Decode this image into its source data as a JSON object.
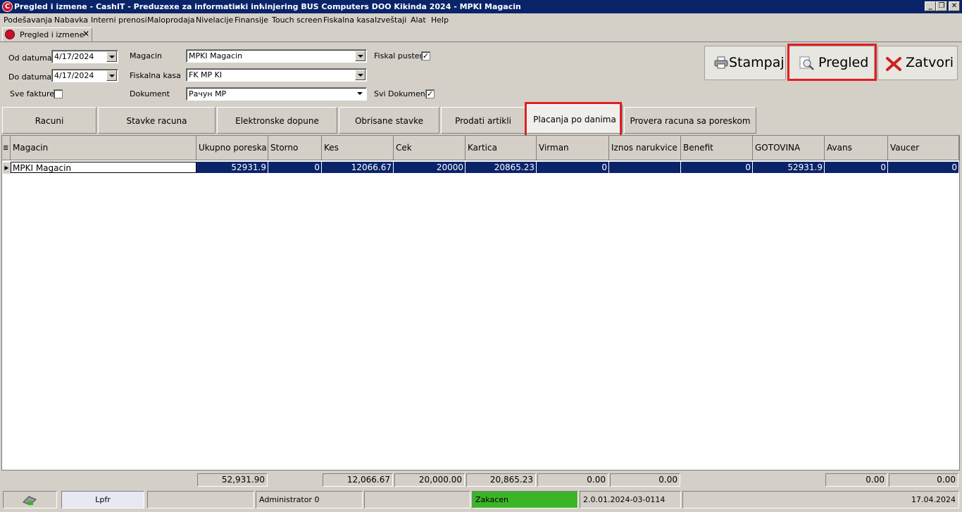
{
  "window": {
    "title": "Pregled i izmene - CashIT - Preduzexe za informatiиki inћinjering BUS Computers DOO Kikinda 2024 - MPKI Magacin",
    "app_icon_letter": "C",
    "minimize": "_",
    "restore": "❐",
    "close": "✕"
  },
  "menu": [
    "Podešavanja",
    "Nabavka",
    "Interni prenosi",
    "Maloprodaja",
    "Nivelacije",
    "Finansije",
    "Touch screen",
    "Fiskalna kasa",
    "Izveštaji",
    "Alat",
    "Help"
  ],
  "doc_tab": {
    "label": "Pregled i izmene",
    "close": "✕"
  },
  "form": {
    "od_datuma_label": "Od datuma",
    "od_datuma_value": "4/17/2024",
    "do_datuma_label": "Do datuma",
    "do_datuma_value": "4/17/2024",
    "sve_fakture_label": "Sve fakture",
    "magacin_label": "Magacin",
    "magacin_value": "MPKI Magacin",
    "fiskalna_kasa_label": "Fiskalna kasa",
    "fiskalna_kasa_value": "FK MP KI",
    "dokument_label": "Dokument",
    "dokument_value": "Рачун МР",
    "fiskal_pusten_label": "Fiskal pusten",
    "fiskal_pusten_checked": "✓",
    "svi_dokumenti_label": "Svi Dokumenti",
    "svi_dokumenti_checked": "✓"
  },
  "buttons": {
    "stampaj": "Stampaj",
    "pregled": "Pregled",
    "zatvori": "Zatvori"
  },
  "tabs": [
    "Racuni",
    "Stavke racuna",
    "Elektronske dopune",
    "Obrisane stavke",
    "Prodati artikli",
    "Placanja po danima",
    "Provera racuna sa poreskom"
  ],
  "active_tab": "Placanja po danima",
  "grid": {
    "columns": [
      "Magacin",
      "Ukupno poreska",
      "Storno",
      "Kes",
      "Cek",
      "Kartica",
      "Virman",
      "Iznos narukvice",
      "Benefit",
      "GOTOVINA",
      "Avans",
      "Vaucer"
    ],
    "rows": [
      [
        "MPKI Magacin",
        "52931.9",
        "0",
        "12066.67",
        "20000",
        "20865.23",
        "0",
        "",
        "0",
        "52931.9",
        "0",
        "0"
      ]
    ],
    "row_indicator": "▶",
    "header_indicator": "≣"
  },
  "totals": {
    "ukupno_poreska": "52,931.90",
    "kes": "12,066.67",
    "cek": "20,000.00",
    "kartica": "20,865.23",
    "virman": "0.00",
    "iznos_narukvice": "0.00",
    "avans": "0.00",
    "vaucer": "0.00"
  },
  "status": {
    "lpfr": "Lpfr",
    "user": "Administrator 0",
    "lock": "Zakacen",
    "version": "2.0.01.2024-03-0114",
    "date": "17.04.2024"
  },
  "colors": {
    "titlebar": "#0a246a",
    "selection": "#0a246a",
    "highlight_box": "#e02020",
    "status_green": "#3cb428"
  }
}
